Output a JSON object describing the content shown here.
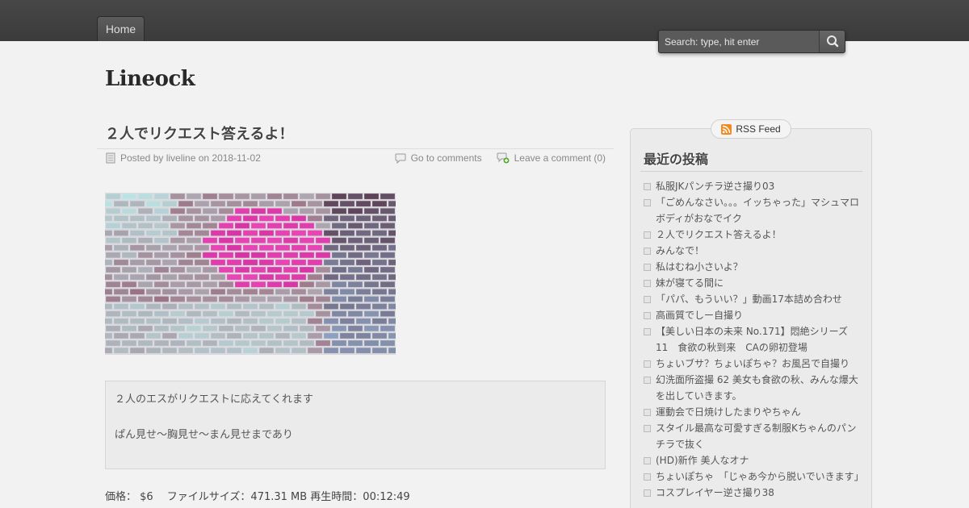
{
  "nav": {
    "home_label": "Home"
  },
  "search": {
    "placeholder": "Search: type, hit enter"
  },
  "site": {
    "title": "Lineock"
  },
  "post": {
    "title": "２人でリクエスト答えるよ！",
    "meta_posted": "Posted by liveline on 2018-11-02",
    "meta_comments": "Go to comments",
    "meta_leave": "Leave a comment (0)",
    "body_line1": "２人のエスがリクエストに応えてくれます",
    "body_line2": "ぱん見せ～胸見せ～まん見せまであり",
    "info": "価格： $6　 ファイルサイズ：471.31 MB 再生時間：00:12:49"
  },
  "sidebar": {
    "rss_label": "RSS Feed",
    "heading": "最近の投稿",
    "recent": [
      "私服JKパンチラ逆さ撮り03",
      "「ごめんなさい。。。イッちゃった」マシュマロボディがおなでイク",
      "２人でリクエスト答えるよ！",
      "みんなで！",
      "私はむね小さいよ？",
      "妹が寝てる間に",
      "「パパ、もういい？」動画17本詰め合わせ",
      "高画質でしー自撮り",
      "【美しい日本の未来 No.171】悶絶シリーズ11　食欲の秋到来　CAの卵初登場",
      "ちょいブサ？ちょいぽちゃ？お風呂で自撮り",
      "幻洗面所盗撮 62 美女も食欲の秋、みんな爆大を出していきます。",
      "運動会で日焼けしたまりやちゃん",
      "スタイル最高な可愛すぎる制服Kちゃんのパンチラで抜く",
      "(HD)新作 美人なオナ",
      "ちょいぽちゃ　「じゃあ今から脱いでいきます」",
      "コスプレイヤー逆さ撮り38"
    ]
  },
  "colors": {
    "topbar": "#3f3f3f",
    "background": "#f2f2f2",
    "content_box": "#ebebeb",
    "rss_orange": "#f08a24"
  },
  "icons": {
    "search": "magnifier-icon",
    "post_meta": "document-icon",
    "comments": "speech-bubble-icon",
    "leave_comment": "add-comment-icon",
    "rss": "rss-icon"
  }
}
